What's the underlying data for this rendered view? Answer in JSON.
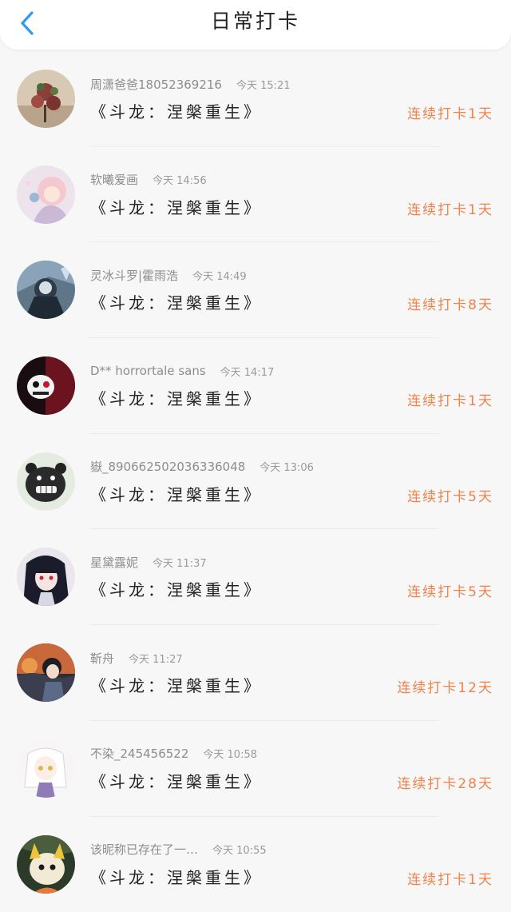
{
  "header": {
    "title": "日常打卡",
    "accent_color": "#2f9bf0"
  },
  "checkins": [
    {
      "user": "周潇爸爸18052369216",
      "time": "今天 15:21",
      "book": "《斗龙：涅槃重生》",
      "streak": "连续打卡1天"
    },
    {
      "user": "软曦爱画",
      "time": "今天 14:56",
      "book": "《斗龙：涅槃重生》",
      "streak": "连续打卡1天"
    },
    {
      "user": "灵冰斗罗|霍雨浩",
      "time": "今天 14:49",
      "book": "《斗龙：涅槃重生》",
      "streak": "连续打卡8天"
    },
    {
      "user": "D** horrortale sans",
      "time": "今天 14:17",
      "book": "《斗龙：涅槃重生》",
      "streak": "连续打卡1天"
    },
    {
      "user": "嶽_890662502036336048",
      "time": "今天 13:06",
      "book": "《斗龙：涅槃重生》",
      "streak": "连续打卡5天"
    },
    {
      "user": "星黛露妮",
      "time": "今天 11:37",
      "book": "《斗龙：涅槃重生》",
      "streak": "连续打卡5天"
    },
    {
      "user": "靳舟",
      "time": "今天 11:27",
      "book": "《斗龙：涅槃重生》",
      "streak": "连续打卡12天"
    },
    {
      "user": "不染_245456522",
      "time": "今天 10:58",
      "book": "《斗龙：涅槃重生》",
      "streak": "连续打卡28天"
    },
    {
      "user": "该昵称已存在了一…",
      "time": "今天 10:55",
      "book": "《斗龙：涅槃重生》",
      "streak": "连续打卡1天"
    }
  ],
  "colors": {
    "streak": "#f0824a",
    "username": "#8d8d8d"
  }
}
